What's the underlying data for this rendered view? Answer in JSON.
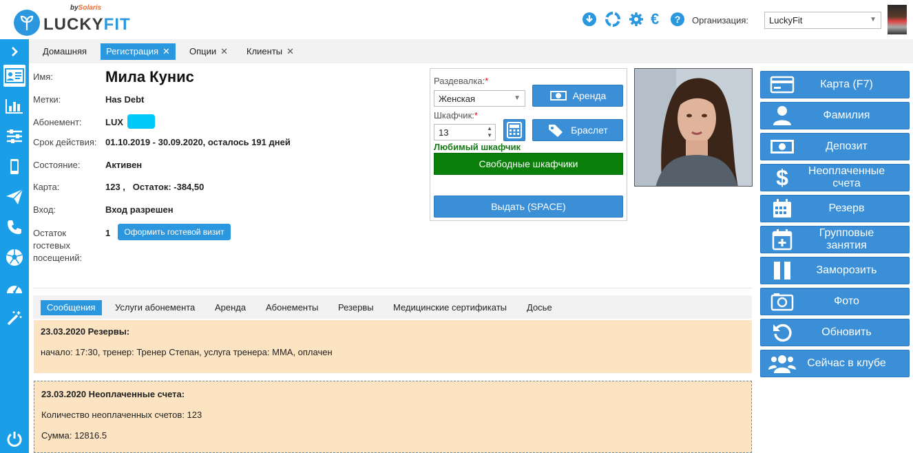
{
  "brand": {
    "name_a": "LUCKY",
    "name_b": "FIT",
    "by": "by",
    "by_brand": "Solaris"
  },
  "org": {
    "label": "Организация:",
    "selected": "LuckyFit"
  },
  "tabs": [
    {
      "label": "Домашняя",
      "active": false
    },
    {
      "label": "Регистрация",
      "active": true,
      "close": "✕"
    },
    {
      "label": "Опции",
      "close": "✕"
    },
    {
      "label": "Клиенты",
      "close": "✕"
    }
  ],
  "client": {
    "name": "Мила Кунис",
    "fields": [
      {
        "label": "Имя:"
      },
      {
        "label": "Метки:",
        "value": "Has Debt"
      },
      {
        "label": "Абонемент:",
        "value": "LUX"
      },
      {
        "label": "Срок действия:",
        "value": "01.10.2019 - 30.09.2020, осталось 191 дней"
      },
      {
        "label": "Состояние:",
        "value": "Активен"
      },
      {
        "label": "Карта:",
        "value": "123 ,   Остаток: -384,50"
      },
      {
        "label": "Вход:",
        "value": "Вход разрешен"
      },
      {
        "label": "Остаток\nгостевых\nпосещений:",
        "value": "1"
      }
    ],
    "guest_button": "Оформить гостевой визит",
    "badge_color": "#00c8f8"
  },
  "locker": {
    "room_label": "Раздевалка:",
    "req": "*",
    "room_value": "Женская",
    "rent_button": "Аренда",
    "locker_label": "Шкафчик:",
    "locker_value": "13",
    "bracelet_button": "Браслет",
    "favorite": "Любимый шкафчик",
    "free_button": "Свободные шкафчики",
    "issue_button": "Выдать (SPACE)"
  },
  "actions": [
    {
      "label": "Карта (F7)",
      "icon": "card-icon"
    },
    {
      "label": "Фамилия",
      "icon": "person-icon"
    },
    {
      "label": "Депозит",
      "icon": "money-icon"
    },
    {
      "label": "Неоплаченные счета",
      "icon": "dollar-icon"
    },
    {
      "label": "Резерв",
      "icon": "calendar-icon"
    },
    {
      "label": "Групповые занятия",
      "icon": "calendar-plus-icon"
    },
    {
      "label": "Заморозить",
      "icon": "pause-icon"
    },
    {
      "label": "Фото",
      "icon": "camera-icon"
    },
    {
      "label": "Обновить",
      "icon": "refresh-icon"
    },
    {
      "label": "Сейчас в клубе",
      "icon": "group-icon"
    }
  ],
  "subtabs": [
    "Сообщения",
    "Услуги абонемента",
    "Аренда",
    "Абонементы",
    "Резервы",
    "Медицинские сертификаты",
    "Досье"
  ],
  "messages": [
    {
      "title": "23.03.2020 Резервы:",
      "lines": [
        "начало: 17:30, тренер: Тренер Степан, услуга тренера: MMA, оплачен"
      ]
    },
    {
      "title": "23.03.2020 Неоплаченные счета:",
      "lines": [
        "Количество неоплаченных счетов: 123",
        "Сумма: 12816.5"
      ]
    }
  ]
}
